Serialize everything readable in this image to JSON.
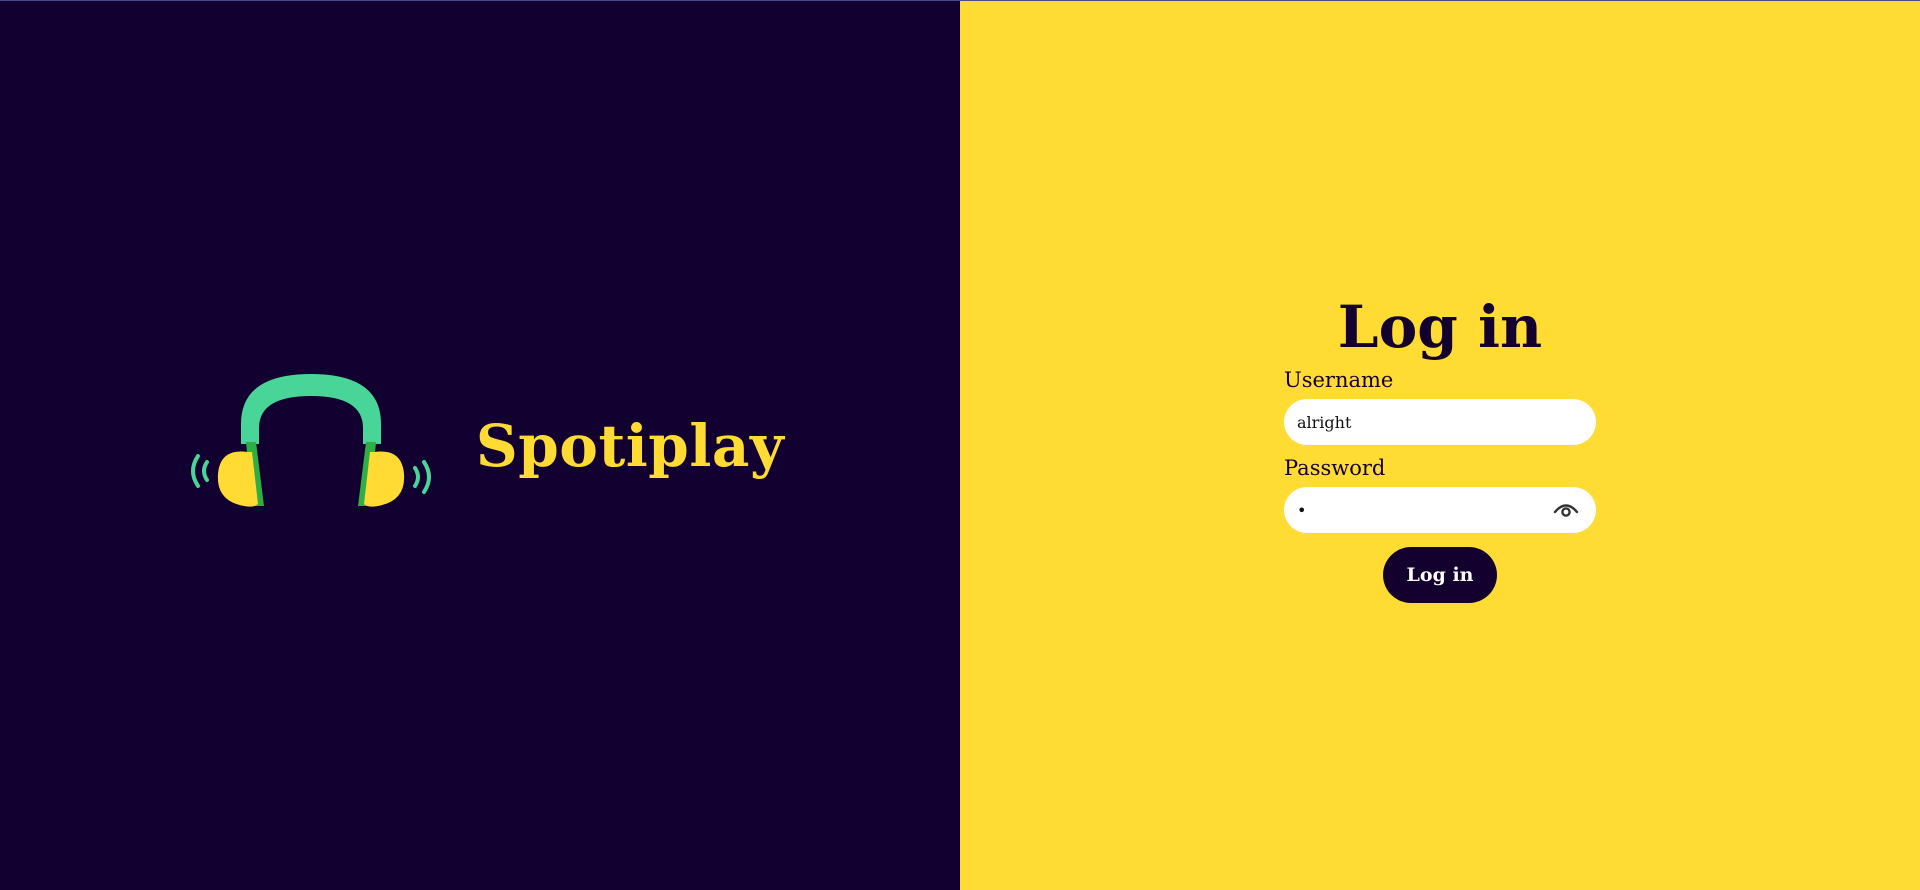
{
  "brand": {
    "name": "Spotiplay",
    "logo_icon": "headphones-icon"
  },
  "login": {
    "title": "Log in",
    "username_label": "Username",
    "username_value": "alright",
    "password_label": "Password",
    "password_value": "•",
    "toggle_visibility_icon": "eye-icon",
    "submit_label": "Log in"
  },
  "colors": {
    "left_bg": "#120030",
    "right_bg": "#ffdc33",
    "accent_yellow": "#ffdb33",
    "accent_green": "#48d597",
    "dark_text": "#14002e"
  }
}
